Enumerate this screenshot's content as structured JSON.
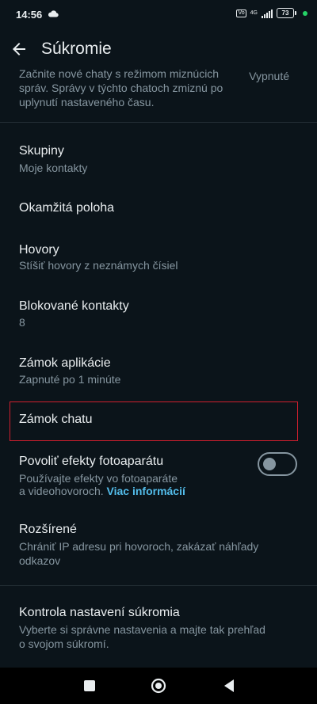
{
  "status_bar": {
    "time": "14:56",
    "volte_label": "Vo",
    "network_label": "4G",
    "battery_level": "73",
    "icons": [
      "cloud-icon",
      "volte-icon",
      "signal-icon",
      "battery-icon",
      "privacy-dot-icon"
    ],
    "accent_color": "#25d366"
  },
  "app_bar": {
    "title": "Súkromie",
    "back_icon": "arrow-back-icon"
  },
  "partial_item": {
    "subtitle": "Začnite nové chaty s režimom miznúcich správ. Správy v týchto chatoch zmiznú po uplynutí nastaveného času.",
    "value": "Vypnuté"
  },
  "items": [
    {
      "title": "Skupiny",
      "subtitle": "Moje kontakty"
    },
    {
      "title": "Okamžitá poloha"
    },
    {
      "title": "Hovory",
      "subtitle": "Stíšiť hovory z neznámych čísiel"
    },
    {
      "title": "Blokované kontakty",
      "subtitle": "8"
    },
    {
      "title": "Zámok aplikácie",
      "subtitle": "Zapnuté po 1 minúte"
    },
    {
      "title": "Zámok chatu"
    },
    {
      "title": "Povoliť efekty fotoaparátu",
      "subtitle_line1": "Používajte efekty vo fotoaparáte",
      "subtitle_line2": "a videohovoroch.",
      "link": "Viac informácií",
      "toggle_state": "off"
    },
    {
      "title": "Rozšírené",
      "subtitle": "Chrániť IP adresu pri hovoroch, zakázať náhľady odkazov"
    },
    {
      "title": "Kontrola nastavení súkromia",
      "subtitle": "Vyberte si správne nastavenia a majte tak prehľad o svojom súkromí."
    }
  ],
  "colors": {
    "background": "#0b141a",
    "primary_text": "#e9edef",
    "secondary_text": "#8696a0",
    "link": "#53bdeb",
    "highlight_border": "#d01f2e"
  },
  "nav_bar": {
    "icons": [
      "recents-square-icon",
      "home-circle-icon",
      "back-triangle-icon"
    ]
  }
}
